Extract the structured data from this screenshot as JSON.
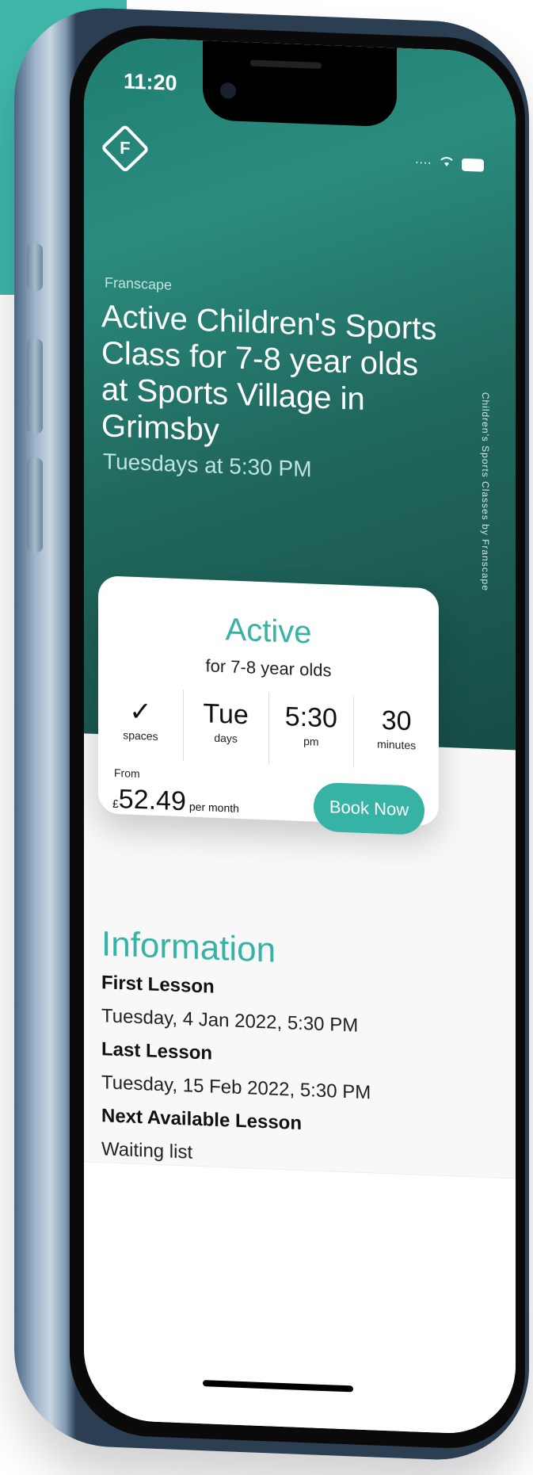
{
  "status_bar": {
    "time": "11:20"
  },
  "hero": {
    "brand": "Franscape",
    "title": "Active Children's Sports Class for 7-8 year olds at Sports Village in Grimsby",
    "schedule": "Tuesdays at 5:30 PM",
    "vertical_label": "Children's Sports Classes by Franscape"
  },
  "card": {
    "title": "Active",
    "subtitle": "for 7-8 year olds",
    "stats": [
      {
        "value": "✓",
        "label": "spaces"
      },
      {
        "value": "Tue",
        "label": "days"
      },
      {
        "value": "5:30",
        "label": "pm"
      },
      {
        "value": "30",
        "label": "minutes"
      }
    ],
    "from_label": "From",
    "currency": "£",
    "price": "52.49",
    "per": "per month",
    "book_label": "Book Now"
  },
  "information": {
    "heading": "Information",
    "items": [
      {
        "label": "First Lesson",
        "value": "Tuesday, 4 Jan 2022, 5:30 PM"
      },
      {
        "label": "Last Lesson",
        "value": "Tuesday, 15 Feb 2022, 5:30 PM"
      },
      {
        "label": "Next Available Lesson",
        "value": "Waiting list"
      }
    ]
  },
  "colors": {
    "accent": "#36b3a5",
    "hero_dark": "#164d46"
  }
}
